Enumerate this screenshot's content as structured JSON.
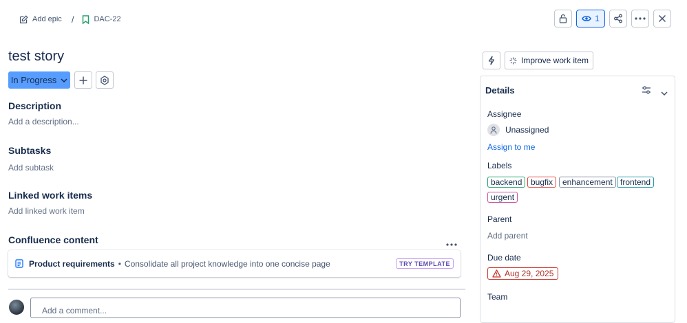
{
  "breadcrumb": {
    "epic_label": "Add epic",
    "separator": "/",
    "issue_key": "DAC-22"
  },
  "toolbar": {
    "watch_count": "1"
  },
  "issue": {
    "title": "test story",
    "status": "In Progress"
  },
  "sections": {
    "description_heading": "Description",
    "description_placeholder": "Add a description...",
    "subtasks_heading": "Subtasks",
    "subtasks_placeholder": "Add subtask",
    "linked_heading": "Linked work items",
    "linked_placeholder": "Add linked work item",
    "confluence_heading": "Confluence content"
  },
  "confluence_card": {
    "title": "Product requirements",
    "separator": "•",
    "description": "Consolidate all project knowledge into one concise page",
    "button": "TRY TEMPLATE"
  },
  "comment": {
    "placeholder": "Add a comment..."
  },
  "right_panel": {
    "improve_label": "Improve work item"
  },
  "details": {
    "heading": "Details",
    "assignee_label": "Assignee",
    "assignee_value": "Unassigned",
    "assign_to_me": "Assign to me",
    "labels_label": "Labels",
    "labels": [
      {
        "text": "backend",
        "color": "#22a06b"
      },
      {
        "text": "bugfix",
        "color": "#e2483d"
      },
      {
        "text": "enhancement",
        "color": "#8590a2"
      },
      {
        "text": "frontend",
        "color": "#1d9aaa"
      },
      {
        "text": "urgent",
        "color": "#cd519d"
      }
    ],
    "parent_label": "Parent",
    "parent_placeholder": "Add parent",
    "due_label": "Due date",
    "due_value": "Aug 29, 2025",
    "team_label": "Team"
  },
  "colors": {
    "status_bg": "#579dff",
    "accent": "#0c66e4",
    "overdue": "#c9372c"
  }
}
